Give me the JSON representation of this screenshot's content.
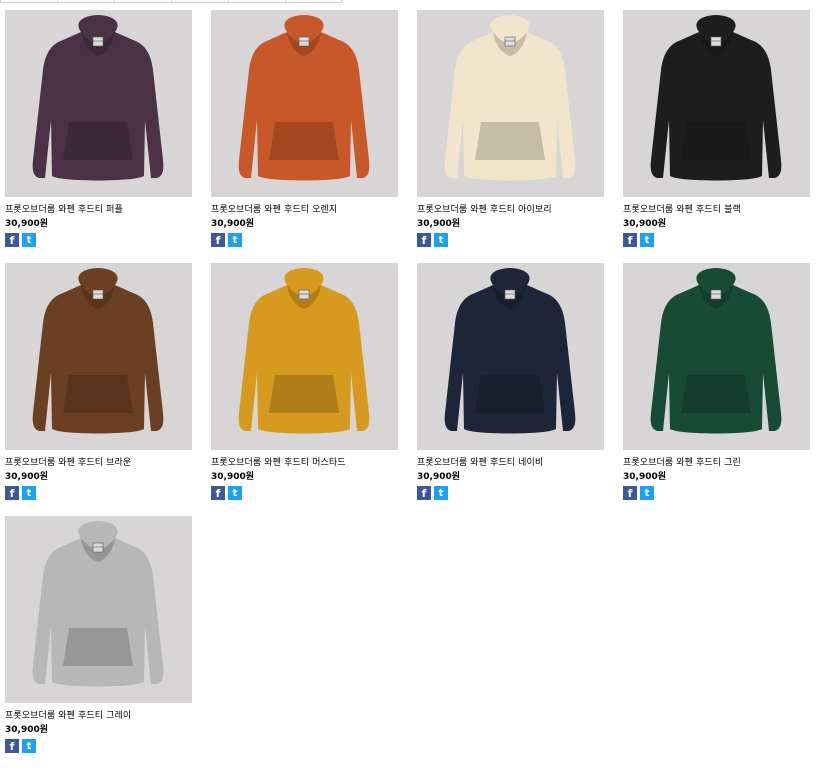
{
  "products": [
    {
      "name": "프롯오브더룸 와펜 후드티 퍼플",
      "price": "30,900원",
      "color": "#4b3146"
    },
    {
      "name": "프롯오브더룸 와펜 후드티 오렌지",
      "price": "30,900원",
      "color": "#c8582a"
    },
    {
      "name": "프롯오브더룸 와펜 후드티 아이보리",
      "price": "30,900원",
      "color": "#f1e6cc"
    },
    {
      "name": "프롯오브더룸 와펜 후드티 블랙",
      "price": "30,900원",
      "color": "#1d1d1d"
    },
    {
      "name": "프롯오브더룸 와펜 후드티 브라운",
      "price": "30,900원",
      "color": "#6b3f22"
    },
    {
      "name": "프롯오브더룸 와펜 후드티 머스타드",
      "price": "30,900원",
      "color": "#d69a1f"
    },
    {
      "name": "프롯오브더룸 와펜 후드티 네이비",
      "price": "30,900원",
      "color": "#1c2638"
    },
    {
      "name": "프롯오브더룸 와펜 후드티 그린",
      "price": "30,900원",
      "color": "#174b33"
    },
    {
      "name": "프롯오브더룸 와펜 후드티 그레이",
      "price": "30,900원",
      "color": "#b7b7b7"
    }
  ],
  "share": {
    "facebook_glyph": "f",
    "twitter_glyph": "t"
  },
  "icons": {
    "facebook": "facebook-icon",
    "twitter": "twitter-icon"
  }
}
